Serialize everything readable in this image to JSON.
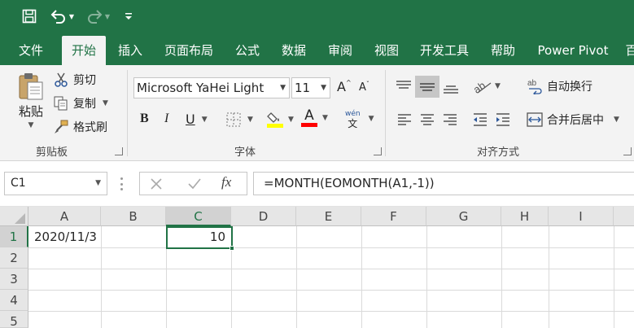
{
  "qat": {
    "save_icon": "save-icon",
    "undo_icon": "undo-icon",
    "redo_icon": "redo-icon",
    "customize_icon": "customize-qat-icon"
  },
  "tabs": [
    "文件",
    "开始",
    "插入",
    "页面布局",
    "公式",
    "数据",
    "审阅",
    "视图",
    "开发工具",
    "帮助",
    "Power Pivot",
    "百"
  ],
  "active_tab": "开始",
  "ribbon": {
    "clipboard": {
      "paste": "粘贴",
      "cut": "剪切",
      "copy": "复制",
      "format_painter": "格式刷",
      "label": "剪贴板"
    },
    "font": {
      "family": "Microsoft YaHei Light",
      "size": "11",
      "bold": "B",
      "italic": "I",
      "underline": "U",
      "grow": "A",
      "shrink": "A",
      "color_a": "A",
      "phonetic_top": "wén",
      "phonetic_bottom": "文",
      "label": "字体"
    },
    "alignment": {
      "wrap_text": "自动换行",
      "merge_center": "合并后居中",
      "label": "对齐方式"
    }
  },
  "formula_bar": {
    "name_box": "C1",
    "fx": "fx",
    "formula": "=MONTH(EOMONTH(A1,-1))"
  },
  "grid": {
    "columns": [
      "A",
      "B",
      "C",
      "D",
      "E",
      "F",
      "G",
      "H",
      "I"
    ],
    "selected_column": "C",
    "rows": [
      "1",
      "2",
      "3",
      "4",
      "5"
    ],
    "selected_row": "1",
    "cells": {
      "A1": "2020/11/3",
      "C1": "10"
    }
  },
  "colors": {
    "brand": "#217346",
    "ribbon_bg": "#f3f3f3",
    "highlight": "#ffff00",
    "font_color": "#ff0000"
  }
}
